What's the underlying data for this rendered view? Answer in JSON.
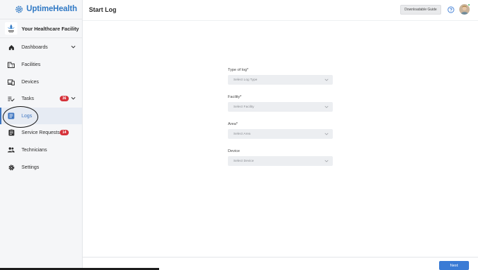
{
  "app": {
    "name": "UptimeHealth",
    "brand_color": "#2f78c4"
  },
  "facility": {
    "name": "Your Healthcare Facility"
  },
  "sidebar": {
    "items": [
      {
        "label": "Dashboards",
        "icon": "home-icon",
        "has_chevron": true
      },
      {
        "label": "Facilities",
        "icon": "building-icon"
      },
      {
        "label": "Devices",
        "icon": "devices-icon"
      },
      {
        "label": "Tasks",
        "icon": "tasks-icon",
        "badge": "36",
        "has_chevron": true
      },
      {
        "label": "Logs",
        "icon": "logs-icon",
        "active": true
      },
      {
        "label": "Service Requests",
        "icon": "clipboard-icon",
        "badge": "14"
      },
      {
        "label": "Technicians",
        "icon": "people-icon"
      },
      {
        "label": "Settings",
        "icon": "gear-icon"
      }
    ]
  },
  "header": {
    "title": "Start Log",
    "guide_button": "Downloadable Guide",
    "help_icon": "help-circle-icon"
  },
  "form": {
    "fields": [
      {
        "label": "Type of log*",
        "placeholder": "Select Log Type"
      },
      {
        "label": "Facility*",
        "placeholder": "Select Facility"
      },
      {
        "label": "Area*",
        "placeholder": "Select Area"
      },
      {
        "label": "Device",
        "placeholder": "Select Device"
      }
    ]
  },
  "footer": {
    "next_label": "Next"
  },
  "colors": {
    "accent": "#3a7bd5",
    "badge": "#d5323a",
    "active_bg": "#e6ebf3"
  }
}
